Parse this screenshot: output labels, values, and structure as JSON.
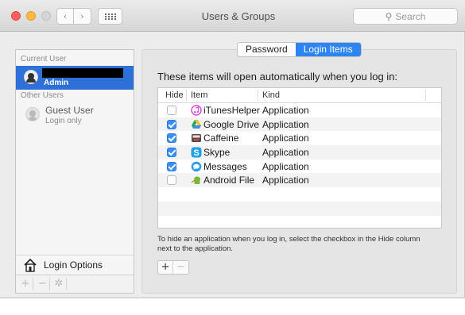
{
  "window": {
    "title": "Users & Groups",
    "search_placeholder": "Search"
  },
  "toolbar": {
    "back_glyph": "‹",
    "forward_glyph": "›"
  },
  "sidebar": {
    "current_user_header": "Current User",
    "current_user_role": "Admin",
    "other_users_header": "Other Users",
    "guest_name": "Guest User",
    "guest_sub": "Login only",
    "login_options_label": "Login Options",
    "add_glyph": "+",
    "remove_glyph": "−",
    "gear_glyph": "✲"
  },
  "tabs": [
    {
      "label": "Password",
      "active": false
    },
    {
      "label": "Login Items",
      "active": true
    }
  ],
  "login_items": {
    "prompt": "These items will open automatically when you log in:",
    "columns": {
      "hide": "Hide",
      "item": "Item",
      "kind": "Kind"
    },
    "rows": [
      {
        "checked": false,
        "name": "iTunesHelper",
        "kind": "Application",
        "icon": "itunes-icon",
        "color": "#d94fd9"
      },
      {
        "checked": true,
        "name": "Google Drive",
        "kind": "Application",
        "icon": "google-drive-icon",
        "color": "#2fa84f"
      },
      {
        "checked": true,
        "name": "Caffeine",
        "kind": "Application",
        "icon": "caffeine-icon",
        "color": "#6a5a5a"
      },
      {
        "checked": true,
        "name": "Skype",
        "kind": "Application",
        "icon": "skype-icon",
        "color": "#1ea0e6"
      },
      {
        "checked": true,
        "name": "Messages",
        "kind": "Application",
        "icon": "messages-icon",
        "color": "#2d9bf0"
      },
      {
        "checked": false,
        "name": "Android File",
        "kind": "Application",
        "icon": "android-file-icon",
        "color": "#79b836"
      }
    ],
    "help_text": "To hide an application when you log in, select the checkbox in the Hide column next to the application.",
    "add_glyph": "+",
    "remove_glyph": "−"
  },
  "colors": {
    "selection_blue": "#2e6fd8",
    "segment_blue": "#2d84f5",
    "checkbox_blue": "#3b8ef5"
  }
}
